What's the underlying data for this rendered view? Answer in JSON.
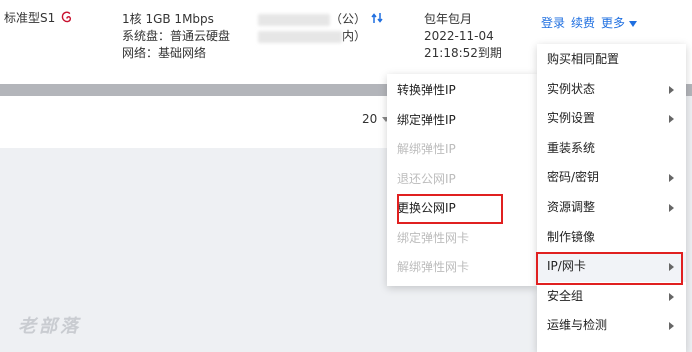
{
  "instance": {
    "spec": "标准型S1",
    "os_icon": "debian-logo-icon",
    "config_line1": "1核 1GB 1Mbps",
    "config_line2": "系统盘：普通云硬盘",
    "config_line3": "网络：基础网络",
    "ip_public_suffix": "（公）",
    "ip_private_suffix": "内）",
    "billing_type": "包年包月",
    "expire_date": "2022-11-04",
    "expire_time": "21:18:52到期"
  },
  "ops": {
    "login": "登录",
    "renew": "续费",
    "more": "更多"
  },
  "pager": {
    "page_size": "20"
  },
  "watermark": "老部落",
  "main_menu": [
    {
      "label": "购买相同配置",
      "arrow": false
    },
    {
      "label": "实例状态",
      "arrow": true
    },
    {
      "label": "实例设置",
      "arrow": true
    },
    {
      "label": "重装系统",
      "arrow": false
    },
    {
      "label": "密码/密钥",
      "arrow": true
    },
    {
      "label": "资源调整",
      "arrow": true
    },
    {
      "label": "制作镜像",
      "arrow": false
    },
    {
      "label": "IP/网卡",
      "arrow": true
    },
    {
      "label": "安全组",
      "arrow": true
    },
    {
      "label": "运维与检测",
      "arrow": true
    }
  ],
  "sub_menu": [
    {
      "label": "转换弹性IP",
      "disabled": false
    },
    {
      "label": "绑定弹性IP",
      "disabled": false
    },
    {
      "label": "解绑弹性IP",
      "disabled": true
    },
    {
      "label": "退还公网IP",
      "disabled": true
    },
    {
      "label": "更换公网IP",
      "disabled": false
    },
    {
      "label": "绑定弹性网卡",
      "disabled": true
    },
    {
      "label": "解绑弹性网卡",
      "disabled": true
    }
  ],
  "colors": {
    "link": "#1f6fe0",
    "highlight": "#e02020",
    "disabled": "#bcbcbc"
  }
}
